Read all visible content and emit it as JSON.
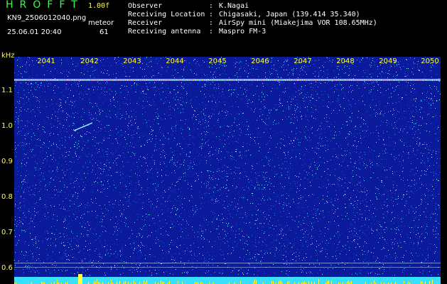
{
  "header": {
    "app_title": "HROFFT",
    "version": "1.00f",
    "filename": "KN9_2506012040.png",
    "meteor_label": "meteor",
    "datetime": "25.06.01 20:40",
    "meteor_count": "61"
  },
  "info": [
    {
      "key": "Observer",
      "value": "K.Nagai"
    },
    {
      "key": "Receiving Location",
      "value": "Chigasaki, Japan (139.414 35.340)"
    },
    {
      "key": "Receiver",
      "value": "AirSpy mini (Miakejima VOR 108.65MHz)"
    },
    {
      "key": "Receiving antenna",
      "value": "Maspro FM-3"
    }
  ],
  "axis": {
    "y_unit": "kHz",
    "y_ticks": [
      "1.1",
      "1.0",
      "0.9",
      "0.8",
      "0.7",
      "0.6"
    ],
    "x_ticks": [
      "2041",
      "2042",
      "2043",
      "2044",
      "2045",
      "2046",
      "2047",
      "2048",
      "2049",
      "2050"
    ]
  },
  "colors": {
    "background": "#0a1a9a",
    "label_yellow": "#ffff3a",
    "title_green": "#2fff4a",
    "signal_cyan": "#37e0ff"
  }
}
